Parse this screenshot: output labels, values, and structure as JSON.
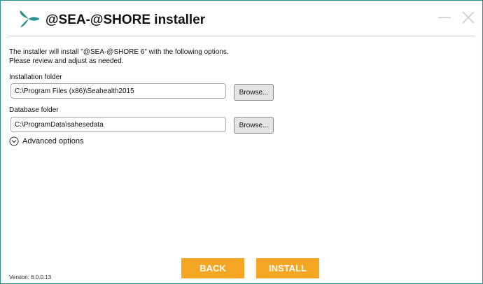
{
  "window": {
    "title": "@SEA-@SHORE installer",
    "accent_color": "#2a8f8f",
    "icons": {
      "logo": "seahealth-logo",
      "minimize": "minimize-icon",
      "close": "close-icon"
    }
  },
  "intro": {
    "line1": "The installer will install \"@SEA-@SHORE 6\" with the following options.",
    "line2": "Please review and adjust as needed."
  },
  "installation": {
    "label": "Installation folder",
    "value": "C:\\Program Files (x86)\\Seahealth2015",
    "browse_label": "Browse..."
  },
  "database": {
    "label": "Database folder",
    "value": "C:\\ProgramData\\sahesedata",
    "browse_label": "Browse..."
  },
  "advanced": {
    "label": "Advanced options",
    "icon": "chevron-down-circle-icon"
  },
  "footer": {
    "version": "Version: 6.0.0.13",
    "back_label": "BACK",
    "install_label": "INSTALL",
    "button_color": "#f5a623"
  }
}
